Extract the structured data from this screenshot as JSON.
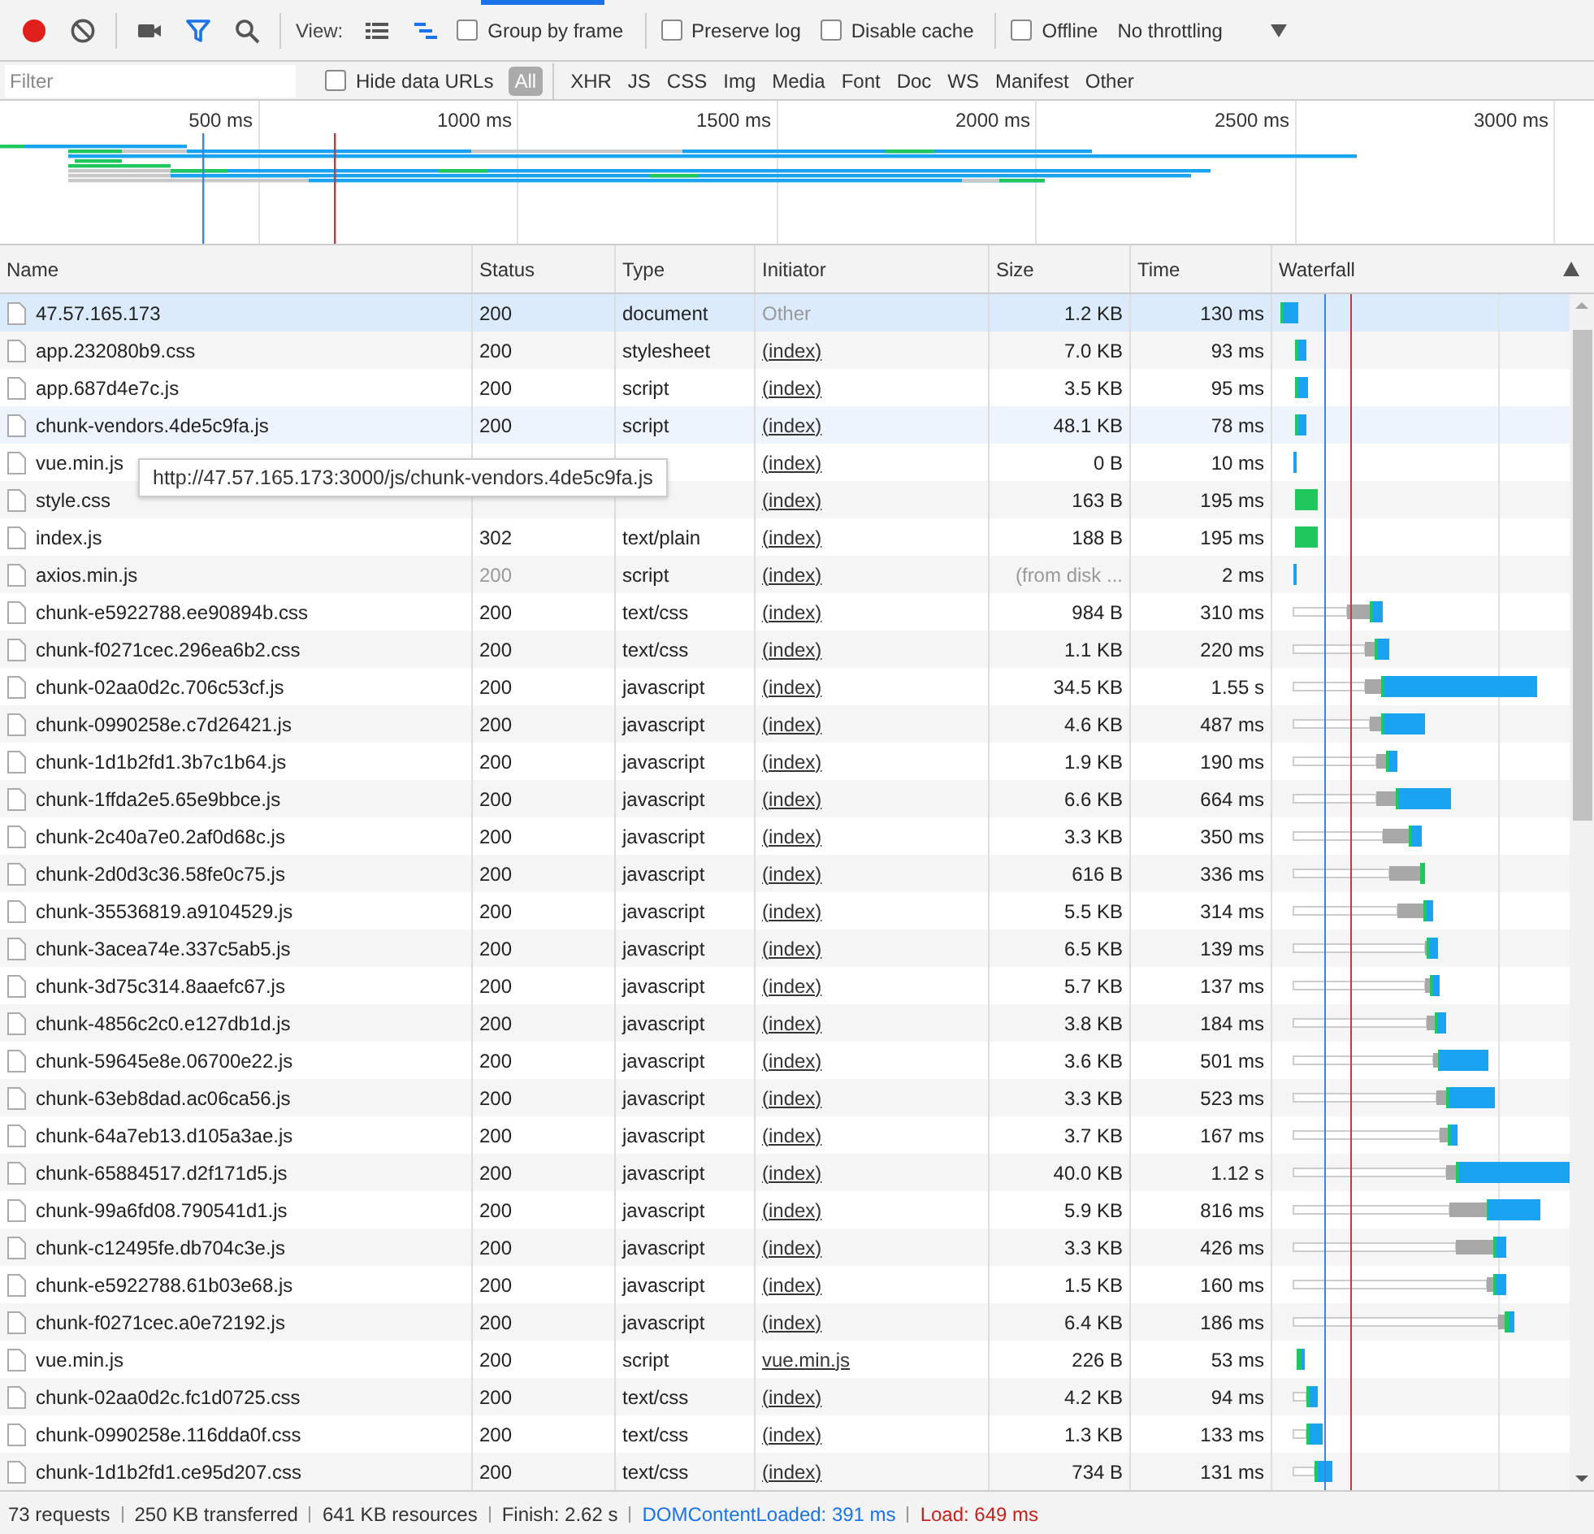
{
  "toolbar": {
    "recording": true,
    "filter_open": true,
    "view_label": "View:",
    "views": [
      {
        "kind": "list",
        "selected": false
      },
      {
        "kind": "waterfall",
        "selected": true
      }
    ],
    "options": [
      {
        "label": "Group by frame",
        "checked": false
      },
      {
        "label": "Preserve log",
        "checked": false
      },
      {
        "label": "Disable cache",
        "checked": false
      },
      {
        "label": "Offline",
        "checked": false
      }
    ],
    "throttling": "No throttling"
  },
  "filter_bar": {
    "placeholder": "Filter",
    "hide_data_urls": {
      "label": "Hide data URLs",
      "checked": false
    },
    "types": [
      {
        "label": "All",
        "selected": true
      },
      {
        "label": "XHR",
        "selected": false
      },
      {
        "label": "JS",
        "selected": false
      },
      {
        "label": "CSS",
        "selected": false
      },
      {
        "label": "Img",
        "selected": false
      },
      {
        "label": "Media",
        "selected": false
      },
      {
        "label": "Font",
        "selected": false
      },
      {
        "label": "Doc",
        "selected": false
      },
      {
        "label": "WS",
        "selected": false
      },
      {
        "label": "Manifest",
        "selected": false
      },
      {
        "label": "Other",
        "selected": false
      }
    ]
  },
  "overview": {
    "ticks": [
      "500 ms",
      "1000 ms",
      "1500 ms",
      "2000 ms",
      "2500 ms",
      "3000 ms"
    ]
  },
  "table": {
    "columns": [
      {
        "label": "Name",
        "sorted": false
      },
      {
        "label": "Status",
        "sorted": false
      },
      {
        "label": "Type",
        "sorted": false
      },
      {
        "label": "Initiator",
        "sorted": false
      },
      {
        "label": "Size",
        "sorted": false
      },
      {
        "label": "Time",
        "sorted": false
      },
      {
        "label": "Waterfall",
        "sorted": true
      }
    ],
    "rows": [
      {
        "name": "47.57.165.173",
        "status": "200",
        "type": "document",
        "initiator": "Other",
        "initiator_link": false,
        "size": "1.2 KB",
        "time": "130 ms",
        "from_cache": false,
        "selected": true,
        "hovered": false
      },
      {
        "name": "app.232080b9.css",
        "status": "200",
        "type": "stylesheet",
        "initiator": "(index)",
        "initiator_link": true,
        "size": "7.0 KB",
        "time": "93 ms",
        "from_cache": false,
        "selected": false,
        "hovered": false
      },
      {
        "name": "app.687d4e7c.js",
        "status": "200",
        "type": "script",
        "initiator": "(index)",
        "initiator_link": true,
        "size": "3.5 KB",
        "time": "95 ms",
        "from_cache": false,
        "selected": false,
        "hovered": false
      },
      {
        "name": "chunk-vendors.4de5c9fa.js",
        "status": "200",
        "type": "script",
        "initiator": "(index)",
        "initiator_link": true,
        "size": "48.1 KB",
        "time": "78 ms",
        "from_cache": false,
        "selected": false,
        "hovered": true
      },
      {
        "name": "vue.min.js",
        "initiator": "(index)",
        "initiator_link": true,
        "size": "0 B",
        "time": "10 ms",
        "from_cache": false,
        "selected": false,
        "hovered": false
      },
      {
        "name": "style.css",
        "initiator": "(index)",
        "initiator_link": true,
        "size": "163 B",
        "time": "195 ms",
        "from_cache": false,
        "selected": false,
        "hovered": false
      },
      {
        "name": "index.js",
        "status": "302",
        "type": "text/plain",
        "initiator": "(index)",
        "initiator_link": true,
        "size": "188 B",
        "time": "195 ms",
        "from_cache": false,
        "selected": false,
        "hovered": false
      },
      {
        "name": "axios.min.js",
        "status": "200",
        "type": "script",
        "initiator": "(index)",
        "initiator_link": true,
        "size": "(from disk ...",
        "time": "2 ms",
        "from_cache": true,
        "selected": false,
        "hovered": false
      },
      {
        "name": "chunk-e5922788.ee90894b.css",
        "status": "200",
        "type": "text/css",
        "initiator": "(index)",
        "initiator_link": true,
        "size": "984 B",
        "time": "310 ms",
        "from_cache": false,
        "selected": false,
        "hovered": false
      },
      {
        "name": "chunk-f0271cec.296ea6b2.css",
        "status": "200",
        "type": "text/css",
        "initiator": "(index)",
        "initiator_link": true,
        "size": "1.1 KB",
        "time": "220 ms",
        "from_cache": false,
        "selected": false,
        "hovered": false
      },
      {
        "name": "chunk-02aa0d2c.706c53cf.js",
        "status": "200",
        "type": "javascript",
        "initiator": "(index)",
        "initiator_link": true,
        "size": "34.5 KB",
        "time": "1.55 s",
        "from_cache": false,
        "selected": false,
        "hovered": false
      },
      {
        "name": "chunk-0990258e.c7d26421.js",
        "status": "200",
        "type": "javascript",
        "initiator": "(index)",
        "initiator_link": true,
        "size": "4.6 KB",
        "time": "487 ms",
        "from_cache": false,
        "selected": false,
        "hovered": false
      },
      {
        "name": "chunk-1d1b2fd1.3b7c1b64.js",
        "status": "200",
        "type": "javascript",
        "initiator": "(index)",
        "initiator_link": true,
        "size": "1.9 KB",
        "time": "190 ms",
        "from_cache": false,
        "selected": false,
        "hovered": false
      },
      {
        "name": "chunk-1ffda2e5.65e9bbce.js",
        "status": "200",
        "type": "javascript",
        "initiator": "(index)",
        "initiator_link": true,
        "size": "6.6 KB",
        "time": "664 ms",
        "from_cache": false,
        "selected": false,
        "hovered": false
      },
      {
        "name": "chunk-2c40a7e0.2af0d68c.js",
        "status": "200",
        "type": "javascript",
        "initiator": "(index)",
        "initiator_link": true,
        "size": "3.3 KB",
        "time": "350 ms",
        "from_cache": false,
        "selected": false,
        "hovered": false
      },
      {
        "name": "chunk-2d0d3c36.58fe0c75.js",
        "status": "200",
        "type": "javascript",
        "initiator": "(index)",
        "initiator_link": true,
        "size": "616 B",
        "time": "336 ms",
        "from_cache": false,
        "selected": false,
        "hovered": false
      },
      {
        "name": "chunk-35536819.a9104529.js",
        "status": "200",
        "type": "javascript",
        "initiator": "(index)",
        "initiator_link": true,
        "size": "5.5 KB",
        "time": "314 ms",
        "from_cache": false,
        "selected": false,
        "hovered": false
      },
      {
        "name": "chunk-3acea74e.337c5ab5.js",
        "status": "200",
        "type": "javascript",
        "initiator": "(index)",
        "initiator_link": true,
        "size": "6.5 KB",
        "time": "139 ms",
        "from_cache": false,
        "selected": false,
        "hovered": false
      },
      {
        "name": "chunk-3d75c314.8aaefc67.js",
        "status": "200",
        "type": "javascript",
        "initiator": "(index)",
        "initiator_link": true,
        "size": "5.7 KB",
        "time": "137 ms",
        "from_cache": false,
        "selected": false,
        "hovered": false
      },
      {
        "name": "chunk-4856c2c0.e127db1d.js",
        "status": "200",
        "type": "javascript",
        "initiator": "(index)",
        "initiator_link": true,
        "size": "3.8 KB",
        "time": "184 ms",
        "from_cache": false,
        "selected": false,
        "hovered": false
      },
      {
        "name": "chunk-59645e8e.06700e22.js",
        "status": "200",
        "type": "javascript",
        "initiator": "(index)",
        "initiator_link": true,
        "size": "3.6 KB",
        "time": "501 ms",
        "from_cache": false,
        "selected": false,
        "hovered": false
      },
      {
        "name": "chunk-63eb8dad.ac06ca56.js",
        "status": "200",
        "type": "javascript",
        "initiator": "(index)",
        "initiator_link": true,
        "size": "3.3 KB",
        "time": "523 ms",
        "from_cache": false,
        "selected": false,
        "hovered": false
      },
      {
        "name": "chunk-64a7eb13.d105a3ae.js",
        "status": "200",
        "type": "javascript",
        "initiator": "(index)",
        "initiator_link": true,
        "size": "3.7 KB",
        "time": "167 ms",
        "from_cache": false,
        "selected": false,
        "hovered": false
      },
      {
        "name": "chunk-65884517.d2f171d5.js",
        "status": "200",
        "type": "javascript",
        "initiator": "(index)",
        "initiator_link": true,
        "size": "40.0 KB",
        "time": "1.12 s",
        "from_cache": false,
        "selected": false,
        "hovered": false
      },
      {
        "name": "chunk-99a6fd08.790541d1.js",
        "status": "200",
        "type": "javascript",
        "initiator": "(index)",
        "initiator_link": true,
        "size": "5.9 KB",
        "time": "816 ms",
        "from_cache": false,
        "selected": false,
        "hovered": false
      },
      {
        "name": "chunk-c12495fe.db704c3e.js",
        "status": "200",
        "type": "javascript",
        "initiator": "(index)",
        "initiator_link": true,
        "size": "3.3 KB",
        "time": "426 ms",
        "from_cache": false,
        "selected": false,
        "hovered": false
      },
      {
        "name": "chunk-e5922788.61b03e68.js",
        "status": "200",
        "type": "javascript",
        "initiator": "(index)",
        "initiator_link": true,
        "size": "1.5 KB",
        "time": "160 ms",
        "from_cache": false,
        "selected": false,
        "hovered": false
      },
      {
        "name": "chunk-f0271cec.a0e72192.js",
        "status": "200",
        "type": "javascript",
        "initiator": "(index)",
        "initiator_link": true,
        "size": "6.4 KB",
        "time": "186 ms",
        "from_cache": false,
        "selected": false,
        "hovered": false
      },
      {
        "name": "vue.min.js",
        "status": "200",
        "type": "script",
        "initiator": "vue.min.js",
        "initiator_link": true,
        "size": "226 B",
        "time": "53 ms",
        "from_cache": false,
        "selected": false,
        "hovered": false
      },
      {
        "name": "chunk-02aa0d2c.fc1d0725.css",
        "status": "200",
        "type": "text/css",
        "initiator": "(index)",
        "initiator_link": true,
        "size": "4.2 KB",
        "time": "94 ms",
        "from_cache": false,
        "selected": false,
        "hovered": false
      },
      {
        "name": "chunk-0990258e.116dda0f.css",
        "status": "200",
        "type": "text/css",
        "initiator": "(index)",
        "initiator_link": true,
        "size": "1.3 KB",
        "time": "133 ms",
        "from_cache": false,
        "selected": false,
        "hovered": false
      },
      {
        "name": "chunk-1d1b2fd1.ce95d207.css",
        "status": "200",
        "type": "text/css",
        "initiator": "(index)",
        "initiator_link": true,
        "size": "734 B",
        "time": "131 ms",
        "from_cache": false,
        "selected": false,
        "hovered": false
      }
    ]
  },
  "tooltip": "http://47.57.165.173:3000/js/chunk-vendors.4de5c9fa.js",
  "status_bar": [
    {
      "text": "73 requests",
      "kind": "plain"
    },
    {
      "text": "250 KB transferred",
      "kind": "plain"
    },
    {
      "text": "641 KB resources",
      "kind": "plain"
    },
    {
      "text": "Finish: 2.62 s",
      "kind": "plain"
    },
    {
      "text": "DOMContentLoaded: 391 ms",
      "kind": "dom"
    },
    {
      "text": "Load: 649 ms",
      "kind": "load"
    }
  ]
}
